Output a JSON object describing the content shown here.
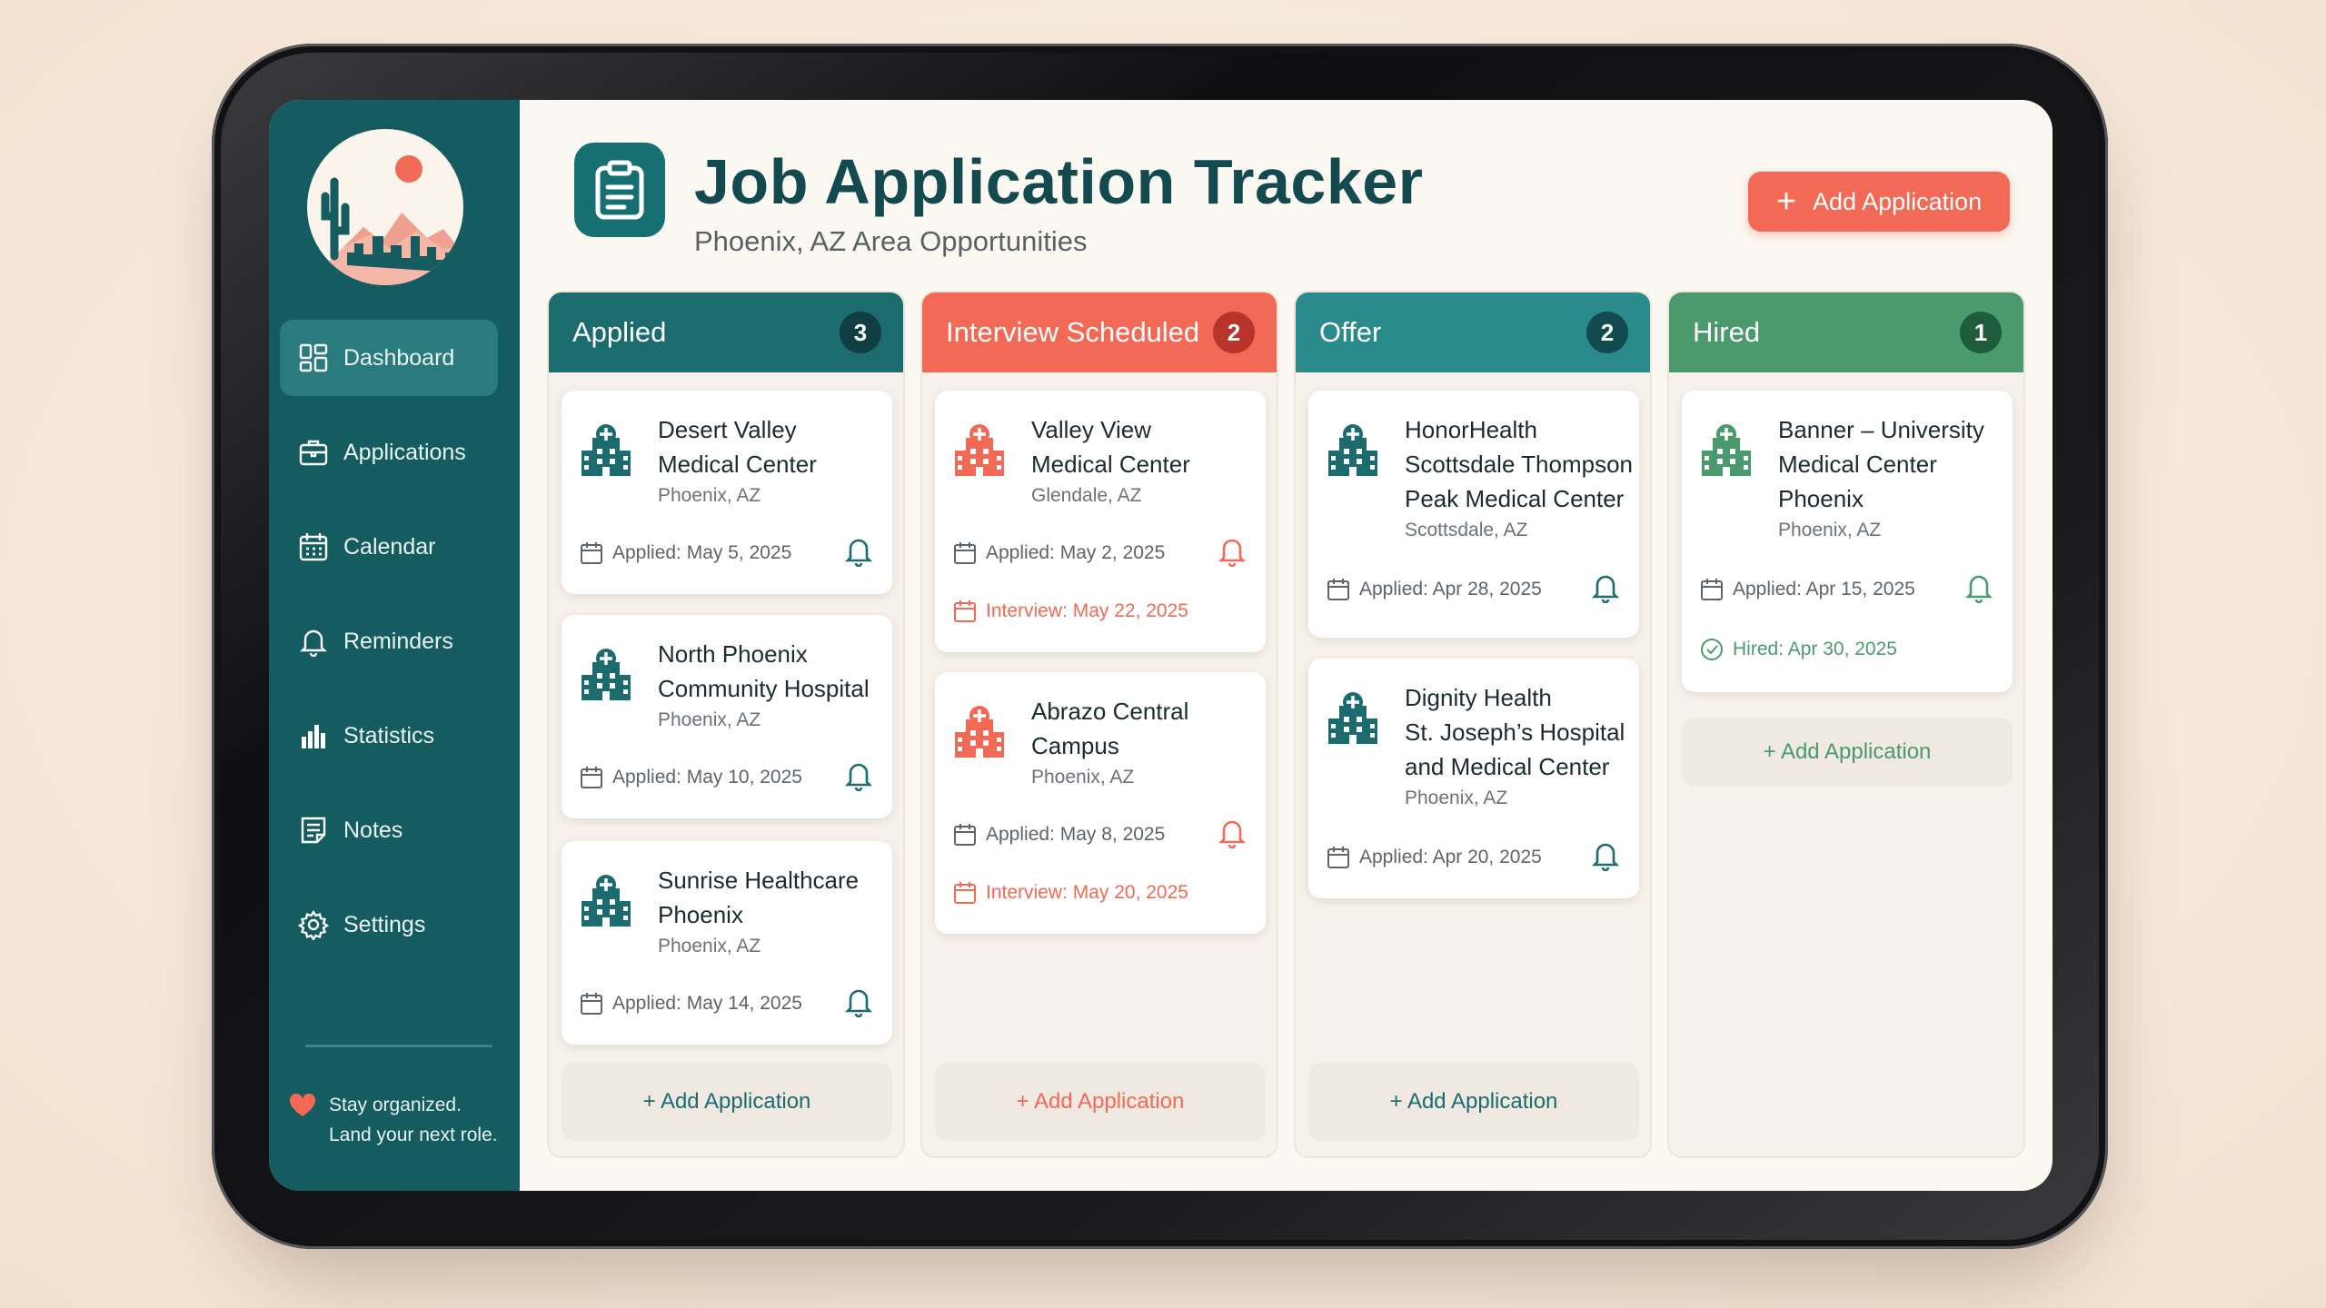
{
  "app": {
    "title": "Job Application Tracker",
    "subtitle": "Phoenix, AZ Area Opportunities",
    "add_button": "Add Application",
    "colors": {
      "teal": "#155c60",
      "coral": "#f26a55",
      "offer": "#2b8a8c",
      "hired": "#4b9a6d"
    }
  },
  "sidebar": {
    "items": [
      {
        "label": "Dashboard",
        "icon": "dashboard-icon",
        "active": true
      },
      {
        "label": "Applications",
        "icon": "briefcase-icon"
      },
      {
        "label": "Calendar",
        "icon": "calendar-icon"
      },
      {
        "label": "Reminders",
        "icon": "bell-icon"
      },
      {
        "label": "Statistics",
        "icon": "bar-chart-icon"
      },
      {
        "label": "Notes",
        "icon": "notes-icon"
      },
      {
        "label": "Settings",
        "icon": "gear-icon"
      }
    ],
    "footer_line1": "Stay organized.",
    "footer_line2": "Land your next role."
  },
  "columns": [
    {
      "title": "Applied",
      "count": "3",
      "add_label": "+ Add Application",
      "cards": [
        {
          "name": [
            "Desert Valley",
            "Medical Center"
          ],
          "location": "Phoenix, AZ",
          "applied": "Applied: May 5, 2025"
        },
        {
          "name": [
            "North Phoenix",
            "Community Hospital"
          ],
          "location": "Phoenix, AZ",
          "applied": "Applied: May 10, 2025"
        },
        {
          "name": [
            "Sunrise Healthcare",
            "Phoenix"
          ],
          "location": "Phoenix, AZ",
          "applied": "Applied: May 14, 2025"
        }
      ]
    },
    {
      "title": "Interview Scheduled",
      "count": "2",
      "add_label": "+ Add Application",
      "cards": [
        {
          "name": [
            "Valley View",
            "Medical Center"
          ],
          "location": "Glendale, AZ",
          "applied": "Applied: May 2, 2025",
          "interview": "Interview: May 22, 2025"
        },
        {
          "name": [
            "Abrazo Central",
            "Campus"
          ],
          "location": "Phoenix, AZ",
          "applied": "Applied: May 8, 2025",
          "interview": "Interview: May 20, 2025"
        }
      ]
    },
    {
      "title": "Offer",
      "count": "2",
      "add_label": "+ Add Application",
      "cards": [
        {
          "name": [
            "HonorHealth",
            "Scottsdale Thompson",
            "Peak Medical Center"
          ],
          "location": "Scottsdale, AZ",
          "applied": "Applied: Apr 28, 2025"
        },
        {
          "name": [
            "Dignity Health",
            "St. Joseph’s Hospital",
            "and Medical Center"
          ],
          "location": "Phoenix, AZ",
          "applied": "Applied: Apr 20, 2025"
        }
      ]
    },
    {
      "title": "Hired",
      "count": "1",
      "add_label": "+ Add Application",
      "cards": [
        {
          "name": [
            "Banner – University",
            "Medical Center",
            "Phoenix"
          ],
          "location": "Phoenix, AZ",
          "applied": "Applied: Apr 15, 2025",
          "hired": "Hired: Apr 30, 2025"
        }
      ]
    }
  ]
}
